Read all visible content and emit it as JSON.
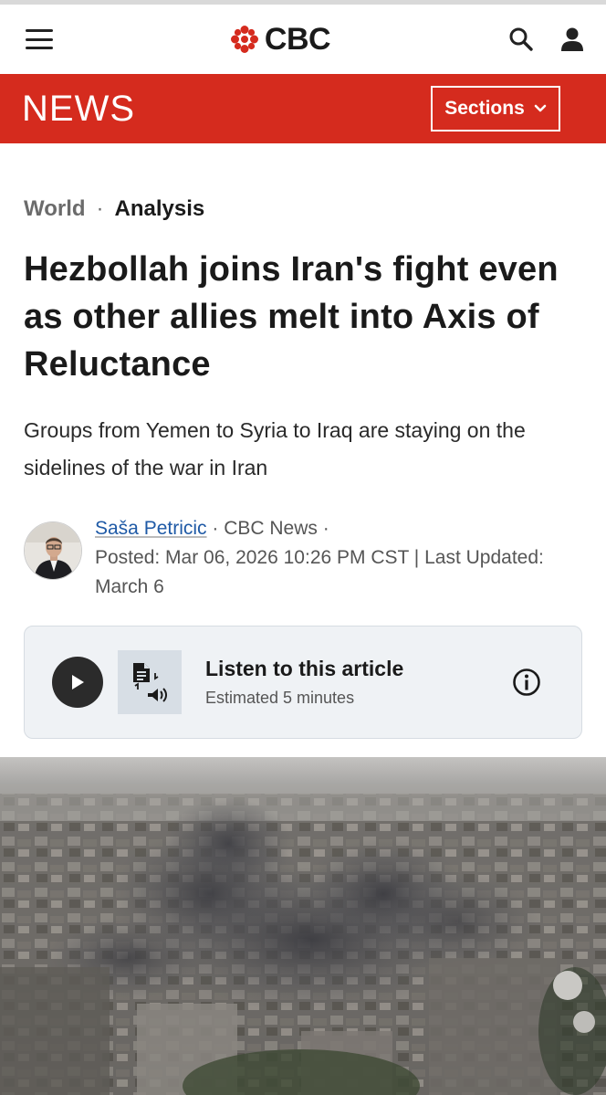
{
  "header": {
    "brand": "CBC",
    "news_label": "NEWS",
    "sections_label": "Sections"
  },
  "article": {
    "section": "World",
    "tag": "Analysis",
    "separator": "·",
    "headline": "Hezbollah joins Iran's fight even as other allies melt into Axis of Reluctance",
    "deck": "Groups from Yemen to Syria to Iraq are staying on the sidelines of the war in Iran",
    "author": "Saša Petricic",
    "outlet": "· CBC News ·",
    "posted": "Posted: Mar 06, 2026 10:26 PM CST | Last Updated: March 6"
  },
  "listen": {
    "title": "Listen to this article",
    "estimate": "Estimated 5 minutes"
  },
  "colors": {
    "brand_red": "#d52b1e",
    "link_blue": "#1f5aa6"
  },
  "icons": [
    "menu-icon",
    "cbc-gem-logo",
    "search-icon",
    "account-icon",
    "chevron-down-icon",
    "play-icon",
    "text-to-speech-icon",
    "info-icon"
  ]
}
